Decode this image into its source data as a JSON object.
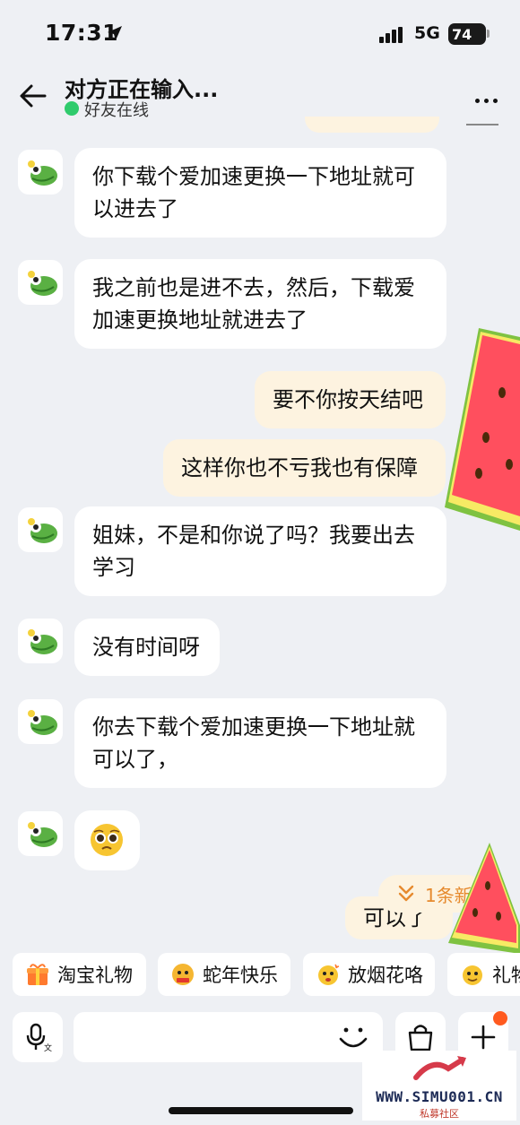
{
  "status_bar": {
    "time": "17:31",
    "network": "5G",
    "battery": "74"
  },
  "header": {
    "title": "对方正在输入...",
    "subtitle": "好友在线"
  },
  "messages": [
    {
      "side": "in",
      "text": "你下载个爱加速更换一下地址就可以进去了"
    },
    {
      "side": "in",
      "text": "我之前也是进不去，然后，下载爱加速更换地址就进去了"
    },
    {
      "side": "out",
      "text": "要不你按天结吧"
    },
    {
      "side": "out",
      "text": "这样你也不亏我也有保障"
    },
    {
      "side": "in",
      "text": "姐妹，不是和你说了吗？我要出去学习"
    },
    {
      "side": "in",
      "text": "没有时间呀"
    },
    {
      "side": "in",
      "text": "你去下载个爱加速更换一下地址就可以了，"
    },
    {
      "side": "in",
      "emoji": "pleading-face-emoji"
    },
    {
      "side": "out",
      "text": "可以了"
    }
  ],
  "unread_pill": {
    "label": "1条新"
  },
  "quick_actions": [
    {
      "label": "淘宝礼物",
      "icon": "gift-icon"
    },
    {
      "label": "蛇年快乐",
      "icon": "snake-sticker-icon"
    },
    {
      "label": "放烟花咯",
      "icon": "firework-sticker-icon"
    },
    {
      "label": "礼物",
      "icon": "sticker-icon"
    }
  ],
  "input_bar": {
    "placeholder": ""
  },
  "watermark": {
    "text": "WWW.SIMU001.CN",
    "sub": "私募社区"
  },
  "colors": {
    "incoming_bubble": "#ffffff",
    "outgoing_bubble": "#fdf3e0",
    "background": "#eef0f4",
    "online": "#2fcb6c",
    "unread_text": "#e68a2e"
  }
}
